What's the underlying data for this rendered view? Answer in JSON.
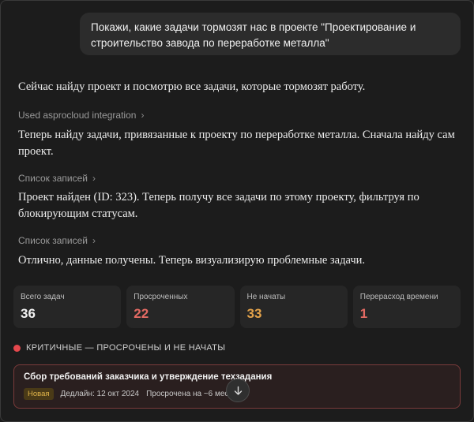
{
  "user_message": "Покажи, какие задачи тормозят нас в проекте \"Проектирование и строительство завода по переработке металла\"",
  "messages": [
    "Сейчас найду проект и посмотрю все задачи, которые тормозят работу.",
    "Теперь найду задачи, привязанные к проекту по переработке металла. Сначала найду сам проект.",
    "Проект найден (ID: 323). Теперь получу все задачи по этому проекту, фильтруя по блокирующим статусам.",
    "Отлично, данные получены. Теперь визуализирую проблемные задачи."
  ],
  "tool_calls": [
    "Used asprocloud integration",
    "Список записей",
    "Список записей"
  ],
  "stats": [
    {
      "label": "Всего задач",
      "value": "36",
      "color": "#f2f2f2"
    },
    {
      "label": "Просроченных",
      "value": "22",
      "color": "#e36a63"
    },
    {
      "label": "Не начаты",
      "value": "33",
      "color": "#e3a24a"
    },
    {
      "label": "Перерасход времени",
      "value": "1",
      "color": "#e36a63"
    }
  ],
  "section": {
    "title": "КРИТИЧНЫЕ — ПРОСРОЧЕНЫ И НЕ НАЧАТЫ",
    "dot_color": "#e5484d"
  },
  "task": {
    "title": "Сбор требований заказчика и утверждение техзадания",
    "badge": "Новая",
    "deadline": "Дедлайн: 12 окт 2024",
    "overdue": "Просрочена на ~6 мес"
  },
  "scroll_icon": "arrow-down-icon"
}
